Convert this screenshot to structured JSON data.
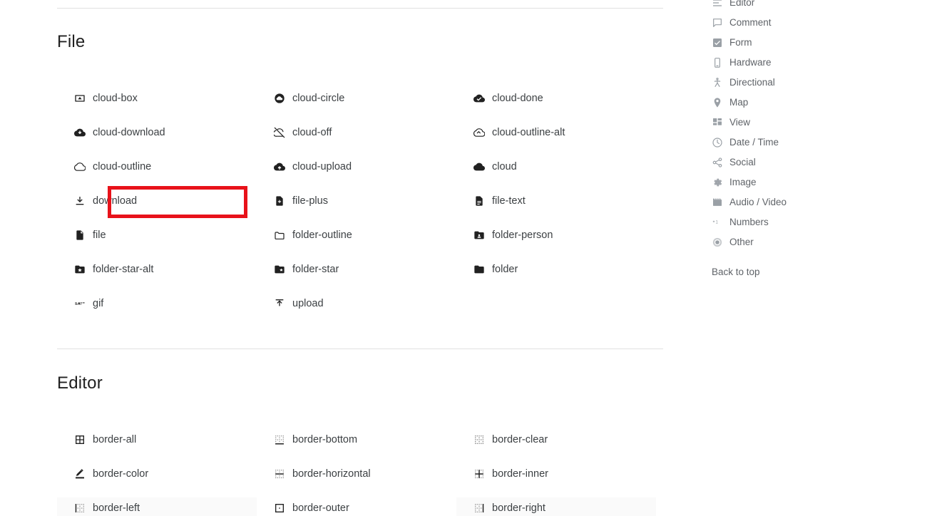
{
  "page": {
    "accent_red": "#e8121a",
    "text_color": "#3c4043",
    "muted_color": "#5f6368",
    "divider_color": "#e0e0e0",
    "back_to_top_label": "Back to top"
  },
  "sections": [
    {
      "title": "File",
      "rows": [
        [
          {
            "icon": "cloud-box-icon",
            "label": "cloud-box"
          },
          {
            "icon": "cloud-circle-icon",
            "label": "cloud-circle"
          },
          {
            "icon": "cloud-done-icon",
            "label": "cloud-done"
          }
        ],
        [
          {
            "icon": "cloud-download-icon",
            "label": "cloud-download"
          },
          {
            "icon": "cloud-off-icon",
            "label": "cloud-off"
          },
          {
            "icon": "cloud-outline-alt-icon",
            "label": "cloud-outline-alt"
          }
        ],
        [
          {
            "icon": "cloud-outline-icon",
            "label": "cloud-outline"
          },
          {
            "icon": "cloud-upload-icon",
            "label": "cloud-upload"
          },
          {
            "icon": "cloud-icon",
            "label": "cloud"
          }
        ],
        [
          {
            "icon": "download-icon",
            "label": "download",
            "highlighted": true
          },
          {
            "icon": "file-plus-icon",
            "label": "file-plus"
          },
          {
            "icon": "file-text-icon",
            "label": "file-text"
          }
        ],
        [
          {
            "icon": "file-icon",
            "label": "file"
          },
          {
            "icon": "folder-outline-icon",
            "label": "folder-outline"
          },
          {
            "icon": "folder-person-icon",
            "label": "folder-person"
          }
        ],
        [
          {
            "icon": "folder-star-alt-icon",
            "label": "folder-star-alt"
          },
          {
            "icon": "folder-star-icon",
            "label": "folder-star"
          },
          {
            "icon": "folder-icon",
            "label": "folder"
          }
        ],
        [
          {
            "icon": "gif-icon",
            "label": "gif"
          },
          {
            "icon": "upload-icon",
            "label": "upload"
          },
          null
        ]
      ]
    },
    {
      "title": "Editor",
      "rows": [
        [
          {
            "icon": "border-all-icon",
            "label": "border-all"
          },
          {
            "icon": "border-bottom-icon",
            "label": "border-bottom"
          },
          {
            "icon": "border-clear-icon",
            "label": "border-clear"
          }
        ],
        [
          {
            "icon": "border-color-icon",
            "label": "border-color"
          },
          {
            "icon": "border-horizontal-icon",
            "label": "border-horizontal"
          },
          {
            "icon": "border-inner-icon",
            "label": "border-inner"
          }
        ],
        [
          {
            "icon": "border-left-icon",
            "label": "border-left",
            "hovered": true
          },
          {
            "icon": "border-outer-icon",
            "label": "border-outer"
          },
          {
            "icon": "border-right-icon",
            "label": "border-right",
            "hovered": true
          }
        ]
      ]
    }
  ],
  "sidebar": {
    "items": [
      {
        "icon": "editor-icon",
        "label": "Editor"
      },
      {
        "icon": "comment-icon",
        "label": "Comment"
      },
      {
        "icon": "form-icon",
        "label": "Form"
      },
      {
        "icon": "hardware-icon",
        "label": "Hardware"
      },
      {
        "icon": "directional-icon",
        "label": "Directional"
      },
      {
        "icon": "map-icon",
        "label": "Map"
      },
      {
        "icon": "view-icon",
        "label": "View"
      },
      {
        "icon": "date-time-icon",
        "label": "Date / Time"
      },
      {
        "icon": "social-icon",
        "label": "Social"
      },
      {
        "icon": "image-icon",
        "label": "Image"
      },
      {
        "icon": "audio-video-icon",
        "label": "Audio / Video"
      },
      {
        "icon": "numbers-icon",
        "label": "Numbers"
      },
      {
        "icon": "other-icon",
        "label": "Other"
      }
    ]
  }
}
